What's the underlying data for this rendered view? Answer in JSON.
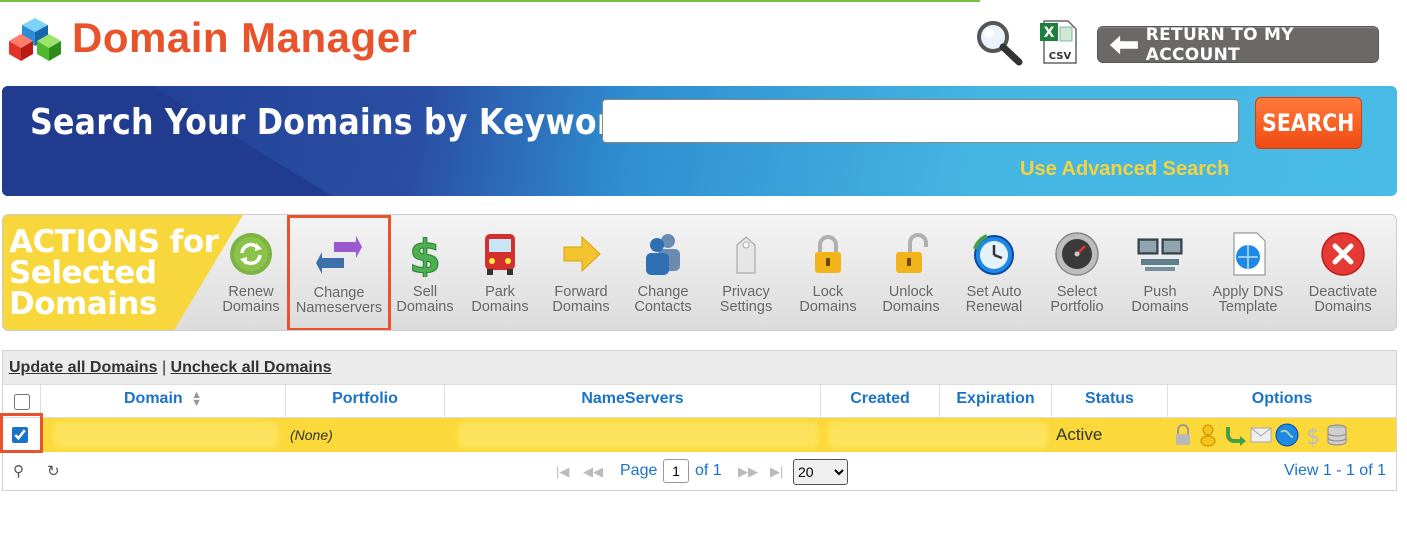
{
  "header": {
    "title": "Domain Manager",
    "csv_label": "CSV",
    "return_label": "RETURN TO MY ACCOUNT"
  },
  "search": {
    "title": "Search Your Domains by Keyword",
    "input_value": "",
    "button_label": "SEARCH",
    "advanced_link": "Use Advanced Search"
  },
  "actions": {
    "title_lines": [
      "ACTIONS for",
      "Selected",
      "Domains"
    ],
    "items": [
      {
        "line1": "Renew",
        "line2": "Domains",
        "icon": "renew-icon"
      },
      {
        "line1": "Change",
        "line2": "Nameservers",
        "icon": "swap-arrows-icon"
      },
      {
        "line1": "Sell",
        "line2": "Domains",
        "icon": "dollar-icon"
      },
      {
        "line1": "Park",
        "line2": "Domains",
        "icon": "bus-icon"
      },
      {
        "line1": "Forward",
        "line2": "Domains",
        "icon": "forward-arrow-icon"
      },
      {
        "line1": "Change",
        "line2": "Contacts",
        "icon": "contacts-icon"
      },
      {
        "line1": "Privacy",
        "line2": "Settings",
        "icon": "privacy-tag-icon"
      },
      {
        "line1": "Lock",
        "line2": "Domains",
        "icon": "lock-icon"
      },
      {
        "line1": "Unlock",
        "line2": "Domains",
        "icon": "unlock-icon"
      },
      {
        "line1": "Set Auto",
        "line2": "Renewal",
        "icon": "clock-icon"
      },
      {
        "line1": "Select",
        "line2": "Portfolio",
        "icon": "gauge-icon"
      },
      {
        "line1": "Push",
        "line2": "Domains",
        "icon": "computers-icon"
      },
      {
        "line1": "Apply DNS",
        "line2": "Template",
        "icon": "dns-template-icon"
      },
      {
        "line1": "Deactivate",
        "line2": "Domains",
        "icon": "deactivate-icon"
      }
    ]
  },
  "grid": {
    "update_all": "Update all Domains",
    "separator": "|",
    "uncheck_all": "Uncheck all Domains",
    "columns": [
      "Domain",
      "Portfolio",
      "NameServers",
      "Created",
      "Expiration",
      "Status",
      "Options"
    ],
    "rows": [
      {
        "checked": true,
        "portfolio": "(None)",
        "status": "Active"
      }
    ],
    "pager": {
      "page_label": "Page",
      "page_value": "1",
      "of_label": "of 1",
      "page_size": "20",
      "view_text": "View 1 - 1 of 1"
    }
  },
  "colors": {
    "brand_orange": "#e8532b",
    "link_blue": "#1a73c8",
    "row_highlight": "#fbd93a",
    "advanced_link": "#f6d33c"
  }
}
